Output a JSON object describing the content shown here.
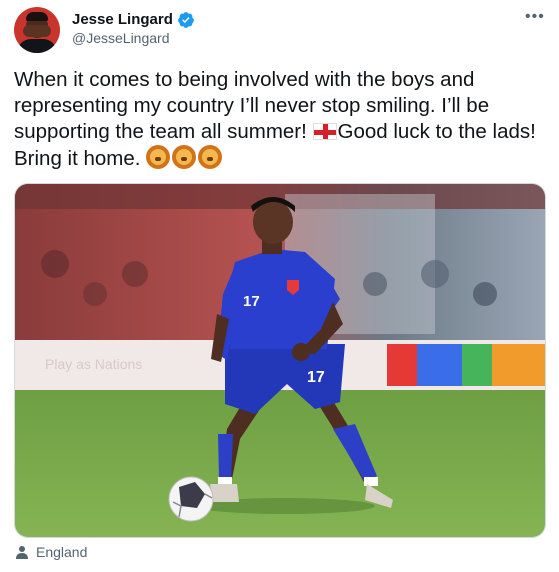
{
  "user": {
    "display_name": "Jesse Lingard",
    "handle": "@JesseLingard",
    "verified": true
  },
  "tweet": {
    "text_part1": "When it comes to being involved with the boys and representing my country I’ll never stop smiling. I’ll be supporting the team all summer! ",
    "text_part2": "Good luck to the lads! Bring it home. ",
    "emojis": [
      "england-flag-icon",
      "lion-face-icon",
      "lion-face-icon",
      "lion-face-icon"
    ]
  },
  "media": {
    "shirt_number": "17",
    "board_text": "Play as Nations"
  },
  "location": {
    "label": "England",
    "icon": "person-icon"
  },
  "colors": {
    "text": "#0f1419",
    "secondary": "#536471",
    "verified": "#1d9bf0",
    "kit_blue": "#2b3fcf",
    "pitch": "#74a844"
  }
}
